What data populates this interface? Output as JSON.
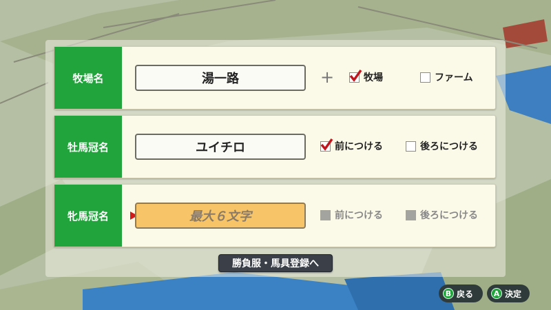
{
  "rows": [
    {
      "label": "牧場名",
      "name": "湯一路",
      "plus": "+",
      "options": [
        {
          "label": "牧場",
          "checked": true
        },
        {
          "label": "ファーム",
          "checked": false
        }
      ]
    },
    {
      "label": "牡馬冠名",
      "name": "ユイチロ",
      "options": [
        {
          "label": "前につける",
          "checked": true
        },
        {
          "label": "後ろにつける",
          "checked": false
        }
      ]
    },
    {
      "label": "牝馬冠名",
      "placeholder": "最大６文字",
      "options": [
        {
          "label": "前につける",
          "checked": false
        },
        {
          "label": "後ろにつける",
          "checked": false
        }
      ]
    }
  ],
  "nav_button": "勝負服・馬具登録へ",
  "controls": [
    {
      "key": "B",
      "label": "戻る"
    },
    {
      "key": "A",
      "label": "決定"
    }
  ],
  "colors": {
    "label_green": "#21a43b",
    "check_red": "#c0161d",
    "active_field": "#f7c567",
    "cursor": "#d11b1b"
  }
}
